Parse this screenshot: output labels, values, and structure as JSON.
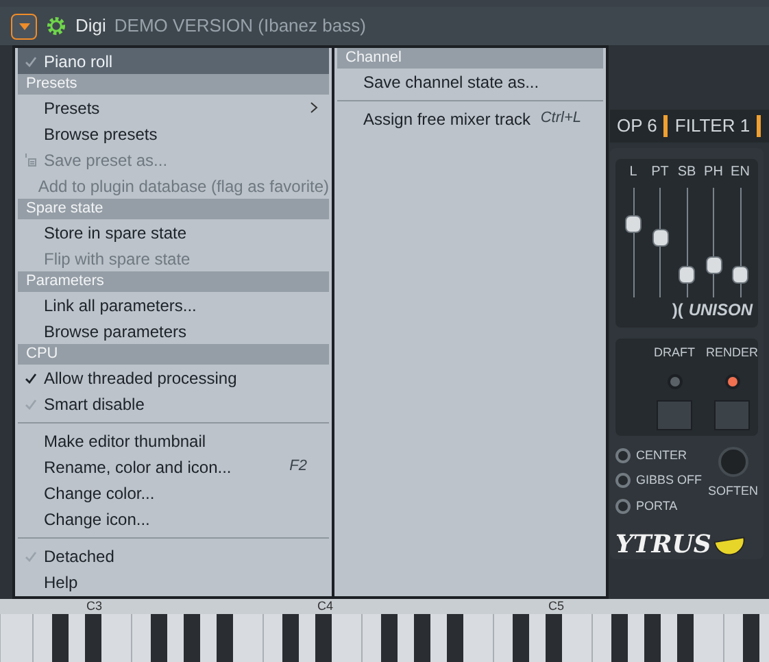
{
  "title_bar": {
    "name": "Digi",
    "subtitle": "DEMO VERSION (Ibanez bass)"
  },
  "menu": [
    {
      "kind": "item",
      "label": "Piano roll",
      "checked": true,
      "check_dimmed": true,
      "selected": true,
      "disabled": false
    },
    {
      "kind": "header",
      "label": "Presets"
    },
    {
      "kind": "item",
      "label": "Presets",
      "selected": false,
      "disabled": false,
      "submenu": true
    },
    {
      "kind": "item",
      "label": "Browse presets",
      "selected": false,
      "disabled": false
    },
    {
      "kind": "item",
      "label": "Save preset as...",
      "selected": false,
      "disabled": true,
      "icon": true
    },
    {
      "kind": "item",
      "label": "Add to plugin database (flag as favorite)",
      "selected": false,
      "disabled": true
    },
    {
      "kind": "header",
      "label": "Spare state"
    },
    {
      "kind": "item",
      "label": "Store in spare state",
      "selected": false,
      "disabled": false
    },
    {
      "kind": "item",
      "label": "Flip with spare state",
      "selected": false,
      "disabled": true
    },
    {
      "kind": "header",
      "label": "Parameters"
    },
    {
      "kind": "item",
      "label": "Link all parameters...",
      "selected": false,
      "disabled": false
    },
    {
      "kind": "item",
      "label": "Browse parameters",
      "selected": false,
      "disabled": false
    },
    {
      "kind": "header",
      "label": "CPU"
    },
    {
      "kind": "item",
      "label": "Allow threaded processing",
      "checked": true,
      "check_dimmed": false,
      "selected": false,
      "disabled": false
    },
    {
      "kind": "item",
      "label": "Smart disable",
      "checked": true,
      "check_dimmed": true,
      "selected": false,
      "disabled": false
    },
    {
      "kind": "separator"
    },
    {
      "kind": "item",
      "label": "Make editor thumbnail",
      "selected": false,
      "disabled": false
    },
    {
      "kind": "item",
      "label": "Rename, color and icon...",
      "shortcut": "F2",
      "selected": false,
      "disabled": false
    },
    {
      "kind": "item",
      "label": "Change color...",
      "selected": false,
      "disabled": false
    },
    {
      "kind": "item",
      "label": "Change icon...",
      "selected": false,
      "disabled": false
    },
    {
      "kind": "separator"
    },
    {
      "kind": "item",
      "label": "Detached",
      "checked": true,
      "check_dimmed": true,
      "selected": false,
      "disabled": false
    },
    {
      "kind": "item",
      "label": "Help",
      "selected": false,
      "disabled": false
    }
  ],
  "submenu": [
    {
      "kind": "header",
      "label": "Channel"
    },
    {
      "kind": "item",
      "label": "Save channel state as...",
      "selected": false,
      "disabled": false
    },
    {
      "kind": "separator"
    },
    {
      "kind": "item",
      "label": "Assign free mixer track",
      "shortcut": "Ctrl+L",
      "selected": false,
      "disabled": false
    }
  ],
  "plugin": {
    "tabs": [
      "OP 6",
      "FILTER 1"
    ],
    "faders": [
      {
        "label": "L",
        "level": 0.7
      },
      {
        "label": "PT",
        "level": 0.55
      },
      {
        "label": "SB",
        "level": 0.15
      },
      {
        "label": "PH",
        "level": 0.25
      },
      {
        "label": "EN",
        "level": 0.15
      }
    ],
    "unison_symbol": ")(",
    "unison": "UNISON",
    "quality": [
      {
        "label": "DRAFT",
        "on": false
      },
      {
        "label": "RENDER",
        "on": true
      }
    ],
    "options": [
      {
        "label": "CENTER",
        "selected": false
      },
      {
        "label": "GIBBS OFF",
        "selected": false
      },
      {
        "label": "PORTA",
        "selected": false
      }
    ],
    "knob": "SOFTEN",
    "logo": "YTRUS"
  },
  "keyboard": {
    "octave_labels": [
      "C3",
      "C4",
      "C5"
    ]
  }
}
